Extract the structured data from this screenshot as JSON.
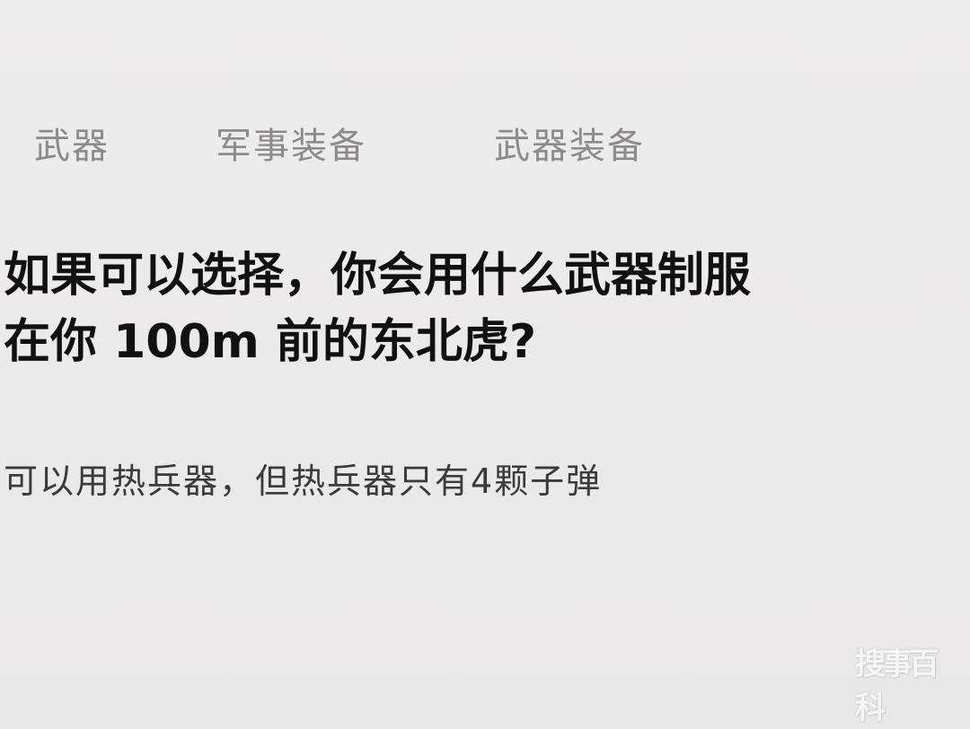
{
  "tags": [
    {
      "label": "武器"
    },
    {
      "label": "军事装备"
    },
    {
      "label": "武器装备"
    }
  ],
  "question": {
    "title_line1": "如果可以选择，你会用什么武器制服",
    "title_line2": "在你 100m 前的东北虎?",
    "description": "可以用热兵器，但热兵器只有4颗子弹"
  },
  "cut_off_text": "…  …",
  "watermark": {
    "text": "搜事百科"
  }
}
